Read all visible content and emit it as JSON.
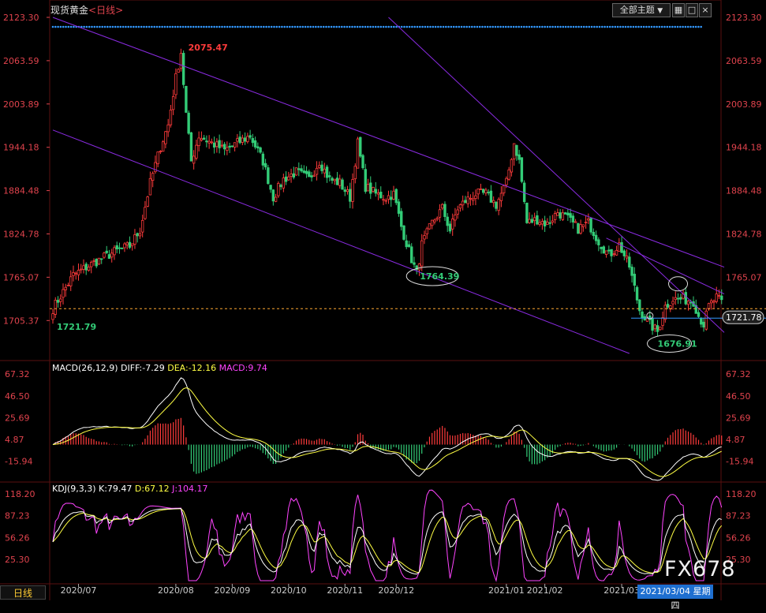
{
  "header": {
    "instrument": "现货黄金",
    "period_tag": "<日线>",
    "theme_dropdown": "全部主题",
    "dropdown_arrow": "▼",
    "toolbar_icons": [
      "grid-icon",
      "restore-icon",
      "close-icon"
    ]
  },
  "footer": {
    "period_button": "日线",
    "cursor_date": "2021/03/04 星期四",
    "watermark": "FX678"
  },
  "colors": {
    "up": "#ff3b3b",
    "down": "#33cc77",
    "channel": "#8a2be2",
    "price_axis": "#e0434d",
    "dif": "#ffffff",
    "dea": "#ffff44",
    "macd": "#ff44ff",
    "k": "#ffffff",
    "d": "#ffff44",
    "j": "#ff44ff",
    "dots": "#3399ff"
  },
  "chart_data": [
    {
      "type": "candlestick",
      "title": "现货黄金 <日线>",
      "y_ticks": [
        "2123.30",
        "2063.59",
        "2003.89",
        "1944.18",
        "1884.48",
        "1824.78",
        "1765.07",
        "1705.37"
      ],
      "x_ticks": [
        "2020/07",
        "2020/08",
        "2020/09",
        "2020/10",
        "2020/11",
        "2020/12",
        "2021/01",
        "2021/02",
        "2021/03"
      ],
      "ylim": [
        1660,
        2123.3
      ],
      "annotations": [
        {
          "label": "2075.47",
          "value": 2075.47,
          "date": "2020/08"
        },
        {
          "label": "1764.39",
          "value": 1764.39,
          "date": "2020/11"
        },
        {
          "label": "1676.91",
          "value": 1676.91,
          "date": "2021/03"
        },
        {
          "label": "1721.79",
          "value": 1721.79,
          "date": "2020/06"
        }
      ],
      "current_price": "1721.78",
      "close_anchors": [
        [
          0,
          1721.79
        ],
        [
          8,
          1768
        ],
        [
          16,
          1785
        ],
        [
          24,
          1800
        ],
        [
          30,
          1808
        ],
        [
          34,
          1830
        ],
        [
          38,
          1895
        ],
        [
          42,
          1945
        ],
        [
          45,
          1975
        ],
        [
          48,
          2040
        ],
        [
          50,
          2075.47
        ],
        [
          52,
          1990
        ],
        [
          54,
          1925
        ],
        [
          57,
          1960
        ],
        [
          62,
          1950
        ],
        [
          67,
          1940
        ],
        [
          72,
          1950
        ],
        [
          77,
          1960
        ],
        [
          82,
          1925
        ],
        [
          86,
          1875
        ],
        [
          90,
          1900
        ],
        [
          95,
          1910
        ],
        [
          100,
          1900
        ],
        [
          104,
          1925
        ],
        [
          108,
          1900
        ],
        [
          112,
          1895
        ],
        [
          116,
          1875
        ],
        [
          119,
          1950
        ],
        [
          122,
          1890
        ],
        [
          126,
          1880
        ],
        [
          130,
          1875
        ],
        [
          133,
          1880
        ],
        [
          136,
          1835
        ],
        [
          140,
          1790
        ],
        [
          142,
          1770
        ],
        [
          144,
          1810
        ],
        [
          148,
          1840
        ],
        [
          152,
          1860
        ],
        [
          155,
          1830
        ],
        [
          158,
          1860
        ],
        [
          161,
          1870
        ],
        [
          165,
          1880
        ],
        [
          169,
          1880
        ],
        [
          173,
          1865
        ],
        [
          177,
          1895
        ],
        [
          180,
          1950
        ],
        [
          182,
          1925
        ],
        [
          185,
          1840
        ],
        [
          189,
          1845
        ],
        [
          193,
          1838
        ],
        [
          197,
          1855
        ],
        [
          201,
          1845
        ],
        [
          205,
          1832
        ],
        [
          209,
          1840
        ],
        [
          213,
          1815
        ],
        [
          217,
          1795
        ],
        [
          221,
          1810
        ],
        [
          225,
          1780
        ],
        [
          229,
          1720
        ],
        [
          233,
          1700
        ],
        [
          236,
          1690
        ],
        [
          239,
          1725
        ],
        [
          242,
          1735
        ],
        [
          246,
          1735
        ],
        [
          250,
          1732
        ],
        [
          252,
          1712
        ],
        [
          254,
          1700
        ],
        [
          256,
          1725
        ],
        [
          259,
          1737
        ],
        [
          261,
          1730
        ]
      ]
    },
    {
      "type": "line",
      "title": "MACD(26,12,9) DIFF:-7.29  DEA:-12.16  MACD:9.74",
      "series": [
        {
          "name": "DIFF",
          "last": "-7.29"
        },
        {
          "name": "DEA",
          "last": "-12.16"
        },
        {
          "name": "MACD",
          "last": "9.74"
        }
      ],
      "y_ticks": [
        "67.32",
        "46.50",
        "25.69",
        "4.87",
        "-15.94"
      ],
      "ylim": [
        -32,
        72
      ]
    },
    {
      "type": "line",
      "title": "KDJ(9,3,3) K:79.47  D:67.12  J:104.17",
      "series": [
        {
          "name": "K",
          "last": "79.47"
        },
        {
          "name": "D",
          "last": "67.12"
        },
        {
          "name": "J",
          "last": "104.17"
        }
      ],
      "y_ticks": [
        "118.20",
        "87.23",
        "56.26",
        "25.30"
      ],
      "ylim": [
        -5,
        125
      ]
    }
  ]
}
